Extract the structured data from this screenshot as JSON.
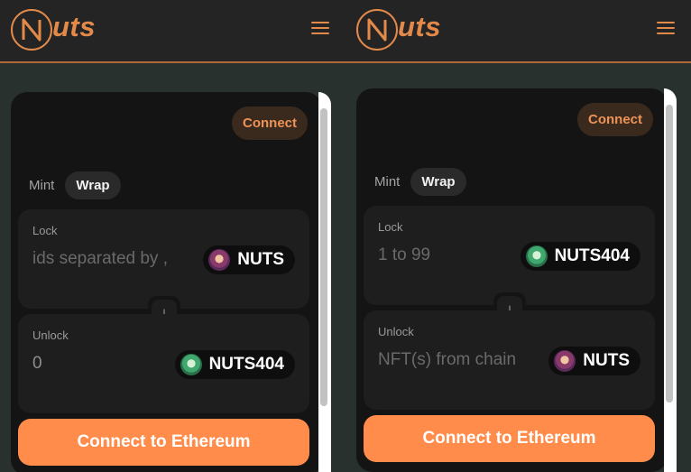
{
  "panes": [
    {
      "brand": "uts",
      "connect_label": "Connect",
      "tabs": [
        "Mint",
        "Wrap"
      ],
      "active_tab": "Wrap",
      "lock": {
        "label": "Lock",
        "placeholder": "ids separated by ,",
        "token": "NUTS",
        "token_icon": "nuts-icon"
      },
      "unlock": {
        "label": "Unlock",
        "value": "0",
        "token": "NUTS404",
        "token_icon": "nuts404-icon"
      },
      "swap_icon": "arrow-down-icon",
      "cta_label": "Connect to Ethereum"
    },
    {
      "brand": "uts",
      "connect_label": "Connect",
      "tabs": [
        "Mint",
        "Wrap"
      ],
      "active_tab": "Wrap",
      "lock": {
        "label": "Lock",
        "placeholder": "1 to 99",
        "token": "NUTS404",
        "token_icon": "nuts404-icon"
      },
      "unlock": {
        "label": "Unlock",
        "value": "NFT(s) from chain",
        "token": "NUTS",
        "token_icon": "nuts-icon"
      },
      "swap_icon": "arrow-down-icon",
      "cta_label": "Connect to Ethereum"
    }
  ],
  "colors": {
    "accent": "#e38a4a",
    "cta": "#ff8c4a",
    "background": "#29312f",
    "card": "#141414",
    "field": "#1e1e1e"
  }
}
